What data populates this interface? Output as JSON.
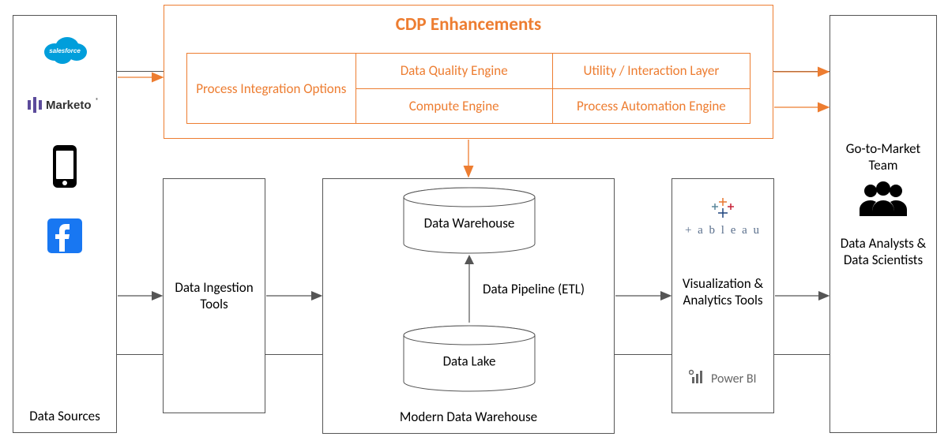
{
  "dataSources": {
    "label": "Data Sources",
    "icons": [
      "salesforce",
      "marketo",
      "phone",
      "facebook"
    ]
  },
  "cdp": {
    "title": "CDP Enhancements",
    "col1": "Process Integration Options",
    "cell_tl": "Data Quality Engine",
    "cell_tr": "Utility / Interaction Layer",
    "cell_bl": "Compute Engine",
    "cell_br": "Process Automation Engine"
  },
  "ingestion": {
    "label": "Data Ingestion Tools"
  },
  "warehouse": {
    "outerLabel": "Modern Data Warehouse",
    "topCyl": "Data Warehouse",
    "bottomCyl": "Data Lake",
    "pipeline": "Data Pipeline (ETL)"
  },
  "viz": {
    "label": "Visualization & Analytics Tools",
    "tableau": "+ a b l e a u",
    "powerbi": "Power BI"
  },
  "right": {
    "topLabel": "Go-to-Market Team",
    "bottomLabel": "Data Analysts & Data Scientists"
  },
  "colors": {
    "orange": "#ed7d31",
    "border": "#555555",
    "salesforceBlue": "#009edb",
    "marketoPurple": "#5c4b9b",
    "facebookBlue": "#1877f2"
  }
}
